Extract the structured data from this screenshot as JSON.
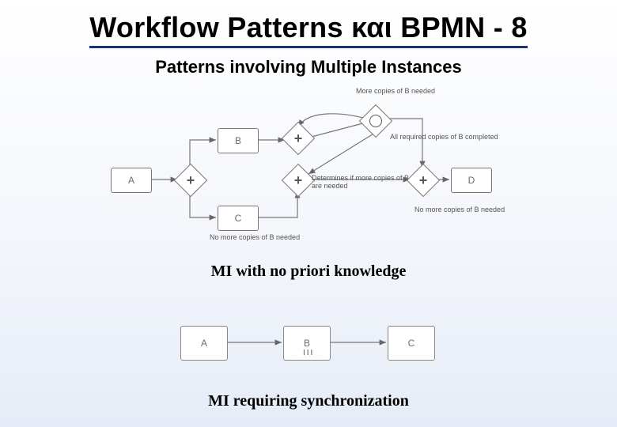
{
  "title": "Workflow Patterns και BPMN - 8",
  "subtitle": "Patterns involving Multiple Instances",
  "caption1": "MI with no priori knowledge",
  "caption2": "MI requiring synchronization",
  "diagram1": {
    "tasks": {
      "A": "A",
      "B": "B",
      "C": "C",
      "D": "D"
    },
    "gatewayPlus": "+",
    "notes": {
      "moreCopies": "More copies of B needed",
      "allRequired": "All required copies of B completed",
      "determine": "Determines if more copies of B are needed",
      "noMore": "No more copies of B needed",
      "noMore2": "No more copies of B needed"
    }
  },
  "diagram2": {
    "tasks": {
      "A": "A",
      "B": "B",
      "C": "C"
    },
    "miMarker": "III"
  }
}
